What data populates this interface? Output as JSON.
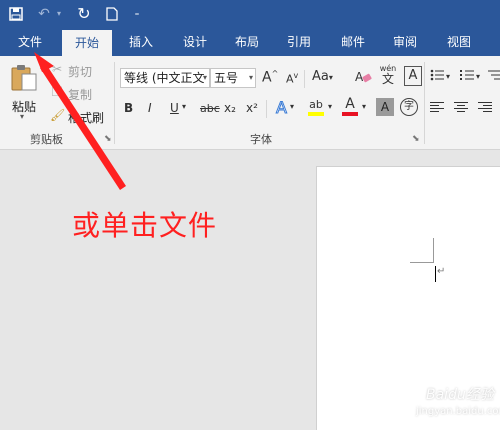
{
  "qat": {
    "save_icon": "save-icon",
    "undo_icon": "undo-icon",
    "redo_icon": "redo-icon",
    "new_icon": "new-document-icon",
    "customize_icon": "customize-qat-icon"
  },
  "tabs": {
    "file": "文件",
    "home": "开始",
    "insert": "插入",
    "design": "设计",
    "layout": "布局",
    "references": "引用",
    "mailings": "邮件",
    "review": "审阅",
    "view": "视图"
  },
  "clipboard": {
    "paste": "粘贴",
    "cut": "剪切",
    "copy": "复制",
    "format_painter": "格式刷",
    "group_label": "剪贴板"
  },
  "font": {
    "font_name": "等线 (中文正文",
    "font_size": "五号",
    "grow": "A",
    "shrink": "A",
    "change_case": "Aa",
    "phonetic_top": "wén",
    "phonetic_bottom": "文",
    "bold": "B",
    "italic": "I",
    "underline": "U",
    "strikethrough": "abc",
    "subscript": "x₂",
    "superscript": "x²",
    "text_effects": "A",
    "highlight": "ab",
    "font_color": "A",
    "char_shading": "A",
    "enclose": "字",
    "group_label": "字体"
  },
  "annotation": "或单击文件",
  "watermark": {
    "text": "Baidu经验",
    "url": "jingyan.baidu.com"
  },
  "colors": {
    "title_bar": "#2b579a",
    "ribbon": "#f3f3f3",
    "annotation": "#ff2020",
    "highlight": "#ffff00",
    "font_color": "#e81123"
  }
}
